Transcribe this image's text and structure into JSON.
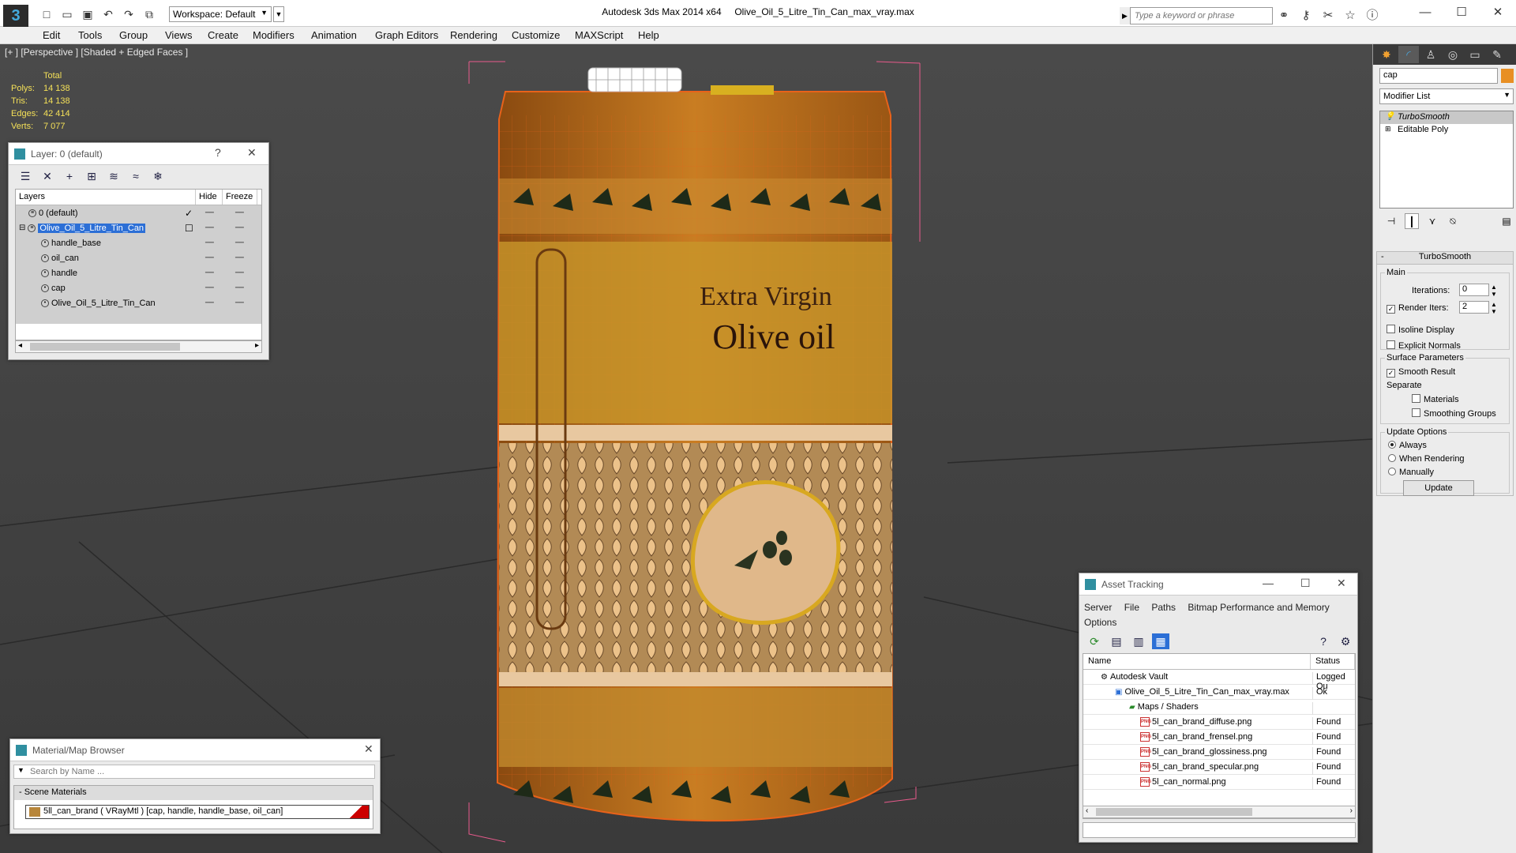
{
  "titlebar": {
    "app_title": "Autodesk 3ds Max  2014 x64",
    "file_name": "Olive_Oil_5_Litre_Tin_Can_max_vray.max",
    "workspace": "Workspace: Default",
    "search_placeholder": "Type a keyword or phrase"
  },
  "menu": [
    "Edit",
    "Tools",
    "Group",
    "Views",
    "Create",
    "Modifiers",
    "Animation",
    "Graph Editors",
    "Rendering",
    "Customize",
    "MAXScript",
    "Help"
  ],
  "viewport": {
    "label": "[+ ] [Perspective ] [Shaded + Edged Faces ]",
    "stats": {
      "header": "Total",
      "polys_label": "Polys:",
      "polys": "14 138",
      "tris_label": "Tris:",
      "tris": "14 138",
      "edges_label": "Edges:",
      "edges": "42 414",
      "verts_label": "Verts:",
      "verts": "7 077"
    },
    "can_text_line1": "Extra Virgin",
    "can_text_line2": "Olive oil"
  },
  "layer_panel": {
    "title": "Layer: 0 (default)",
    "col_layers": "Layers",
    "col_hide": "Hide",
    "col_freeze": "Freeze",
    "rows": [
      {
        "name": "0 (default)"
      },
      {
        "name": "Olive_Oil_5_Litre_Tin_Can"
      },
      {
        "name": "handle_base"
      },
      {
        "name": "oil_can"
      },
      {
        "name": "handle"
      },
      {
        "name": "cap"
      },
      {
        "name": "Olive_Oil_5_Litre_Tin_Can"
      }
    ]
  },
  "material_browser": {
    "title": "Material/Map Browser",
    "search_placeholder": "Search by Name ...",
    "group": "- Scene Materials",
    "material": "5ll_can_brand  ( VRayMtl )  [cap, handle, handle_base, oil_can]"
  },
  "asset_tracking": {
    "title": "Asset Tracking",
    "menu": [
      "Server",
      "File",
      "Paths",
      "Bitmap Performance and Memory"
    ],
    "menu2": "Options",
    "col_name": "Name",
    "col_status": "Status",
    "rows": [
      {
        "name": "Autodesk Vault",
        "status": "Logged Ou"
      },
      {
        "name": "Olive_Oil_5_Litre_Tin_Can_max_vray.max",
        "status": "Ok"
      },
      {
        "name": "Maps / Shaders",
        "status": ""
      },
      {
        "name": "5l_can_brand_diffuse.png",
        "status": "Found"
      },
      {
        "name": "5l_can_brand_frensel.png",
        "status": "Found"
      },
      {
        "name": "5l_can_brand_glossiness.png",
        "status": "Found"
      },
      {
        "name": "5l_can_brand_specular.png",
        "status": "Found"
      },
      {
        "name": "5l_can_normal.png",
        "status": "Found"
      }
    ]
  },
  "command_panel": {
    "object_name": "cap",
    "modifier_list": "Modifier List",
    "stack": [
      "TurboSmooth",
      "Editable Poly"
    ],
    "rollout_title": "TurboSmooth",
    "main_label": "Main",
    "iterations_label": "Iterations:",
    "iterations": "0",
    "render_iters_label": "Render Iters:",
    "render_iters": "2",
    "isoline": "Isoline Display",
    "explicit_normals": "Explicit Normals",
    "surface_params": "Surface Parameters",
    "smooth_result": "Smooth Result",
    "separate": "Separate",
    "materials": "Materials",
    "smoothing_groups": "Smoothing Groups",
    "update_options": "Update Options",
    "always": "Always",
    "when_rendering": "When Rendering",
    "manually": "Manually",
    "update_button": "Update"
  },
  "colors": {
    "accent": "#2c6fd6",
    "stats_yellow": "#f4e058",
    "wire_orange": "#e8621a",
    "object_color": "#e88f23"
  }
}
